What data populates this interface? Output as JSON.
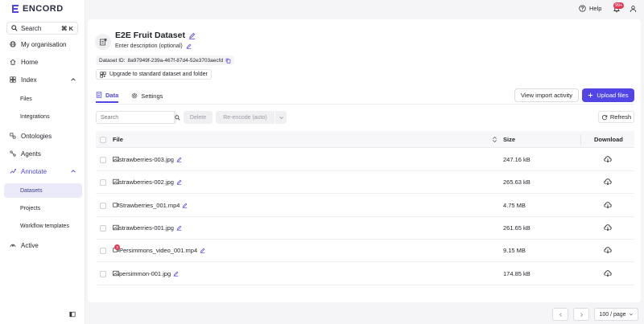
{
  "brand": {
    "name": "ENCORD",
    "accent": "#5146e5",
    "alert": "#e03a58"
  },
  "sidebar": {
    "search": {
      "label": "Search",
      "shortcut": "⌘ K"
    },
    "items": [
      {
        "label": "My organisation",
        "icon": "globe-icon"
      },
      {
        "label": "Home",
        "icon": "home-icon"
      },
      {
        "label": "Index",
        "icon": "index-icon"
      },
      {
        "label": "Files"
      },
      {
        "label": "Integrations"
      },
      {
        "label": "Ontologies",
        "icon": "ontology-icon"
      },
      {
        "label": "Agents",
        "icon": "agents-icon"
      },
      {
        "label": "Annotate",
        "icon": "annotate-icon"
      },
      {
        "label": "Datasets"
      },
      {
        "label": "Projects"
      },
      {
        "label": "Workflow templates"
      },
      {
        "label": "Active",
        "icon": "active-icon"
      }
    ]
  },
  "topbar": {
    "help": "Help",
    "notifications": "99+"
  },
  "dataset": {
    "title": "E2E Fruit Dataset",
    "description": "Enter description (optional)",
    "id_label": "Dataset ID:",
    "id_value": "8a97949f-239a-467f-87d4-52e3703aecfd",
    "upgrade": "Upgrade to standard dataset and folder"
  },
  "tabs": [
    {
      "label": "Data"
    },
    {
      "label": "Settings"
    }
  ],
  "actions": {
    "import_activity": "View import activity",
    "upload": "Upload files"
  },
  "toolbar": {
    "search_placeholder": "Search",
    "delete": "Delete",
    "reencode": "Re-encode (auto)",
    "refresh": "Refresh"
  },
  "table": {
    "columns": {
      "file": "File",
      "size": "Size",
      "download": "Download"
    },
    "rows": [
      {
        "name": "strawberries-003.jpg",
        "size": "247.16 kB",
        "type": "image"
      },
      {
        "name": "strawberries-002.jpg",
        "size": "265.63 kB",
        "type": "image"
      },
      {
        "name": "Strawberries_001.mp4",
        "size": "4.75 MB",
        "type": "video"
      },
      {
        "name": "strawberries-001.jpg",
        "size": "261.65 kB",
        "type": "image"
      },
      {
        "name": "Persimmons_video_001.mp4",
        "size": "9.15 MB",
        "type": "video",
        "badge": "3"
      },
      {
        "name": "persimmon-001.jpg",
        "size": "174.85 kB",
        "type": "image"
      }
    ]
  },
  "pagination": {
    "per_page": "100 / page"
  }
}
